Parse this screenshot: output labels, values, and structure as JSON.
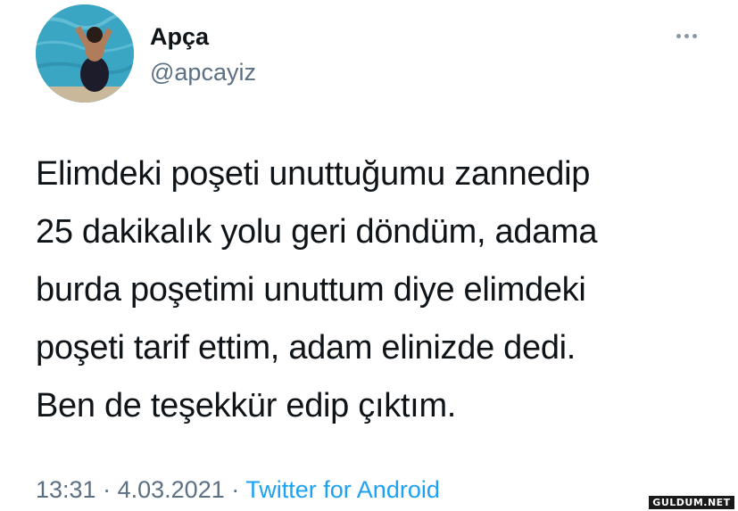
{
  "tweet": {
    "author": {
      "display_name": "Apça",
      "handle": "@apcayiz"
    },
    "text_lines": [
      "Elimdeki poşeti unuttuğumu zannedip",
      "25 dakikalık yolu geri döndüm, adama",
      "burda poşetimi unuttum diye elimdeki",
      "poşeti tarif ettim, adam elinizde dedi.",
      "Ben de teşekkür edip çıktım."
    ],
    "time": "13:31",
    "date": "4.03.2021",
    "separator": "·",
    "source": "Twitter for Android",
    "more_icon": "more-horizontal-icon"
  },
  "watermark": {
    "text": "GULDUM.NET"
  },
  "colors": {
    "text": "#0f1419",
    "secondary": "#5b7083",
    "link": "#1da1f2",
    "avatar_water": "#3aa6c4"
  }
}
